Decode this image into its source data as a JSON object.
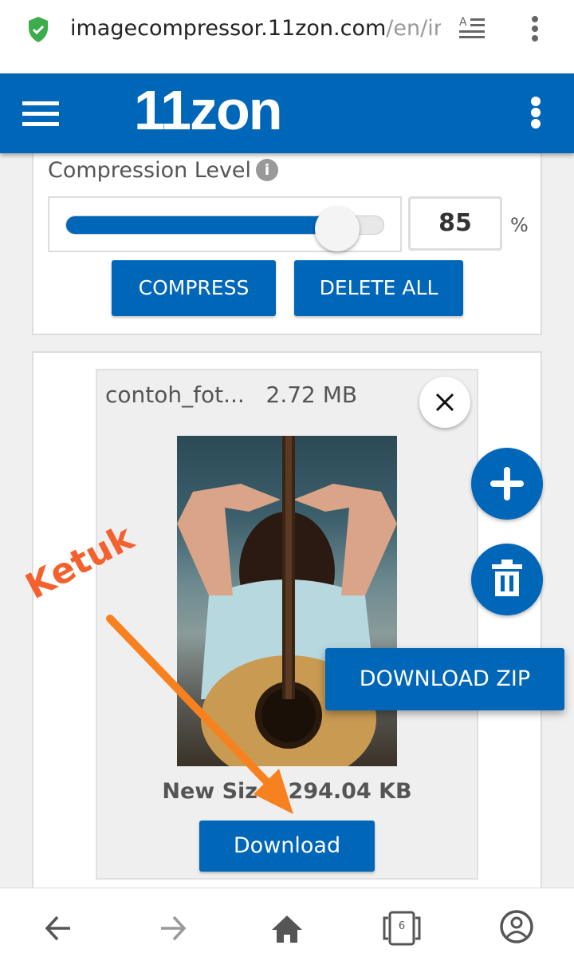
{
  "browser": {
    "url_host": "imagecompressor.11zon.com",
    "url_path": "/en/ima",
    "tab_count": "6"
  },
  "header": {
    "logo": "11zon"
  },
  "compression": {
    "label": "Compression Level",
    "info": "i",
    "value": "85",
    "percent_sign": "%",
    "level_percent": 85,
    "compress_label": "COMPRESS",
    "delete_all_label": "DELETE ALL"
  },
  "file": {
    "name": "contoh_fot...",
    "size": "2.72 MB",
    "new_size_label": "New Size: 294.04 KB",
    "download_label": "Download"
  },
  "actions": {
    "download_zip_label": "DOWNLOAD ZIP"
  },
  "annotation": {
    "text": "Ketuk",
    "color": "#f4612e",
    "arrow_color": "#f7811f"
  },
  "colors": {
    "brand": "#0066b8"
  }
}
